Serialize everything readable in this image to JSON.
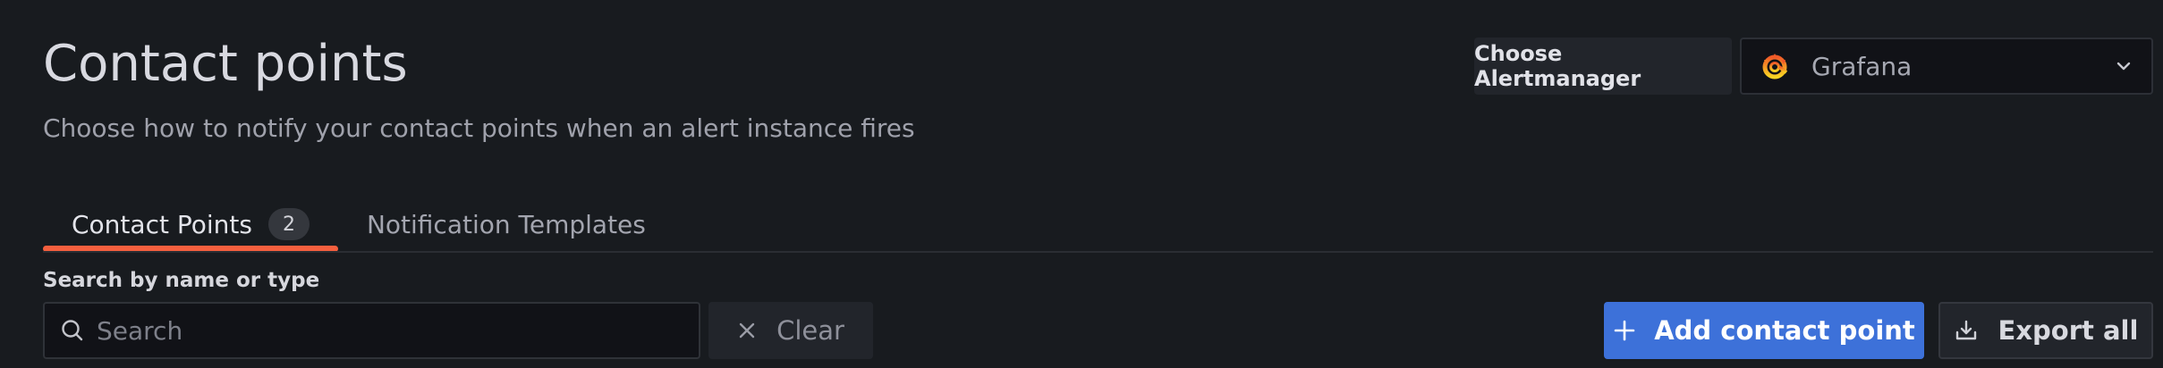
{
  "header": {
    "title": "Contact points",
    "subtitle": "Choose how to notify your contact points when an alert instance fires"
  },
  "alertmanager": {
    "label": "Choose Alertmanager",
    "selected": "Grafana",
    "logo_icon": "grafana-logo-icon",
    "chevron_icon": "chevron-down-icon"
  },
  "tabs": [
    {
      "label": "Contact Points",
      "count": "2",
      "active": true
    },
    {
      "label": "Notification Templates",
      "active": false
    }
  ],
  "search": {
    "label": "Search by name or type",
    "placeholder": "Search",
    "value": "",
    "icon": "search-icon"
  },
  "actions": {
    "clear_label": "Clear",
    "add_label": "Add contact point",
    "export_label": "Export all"
  },
  "colors": {
    "background": "#181b1f",
    "accent_tab": "#f55f3e",
    "primary_button": "#3d71d9"
  }
}
